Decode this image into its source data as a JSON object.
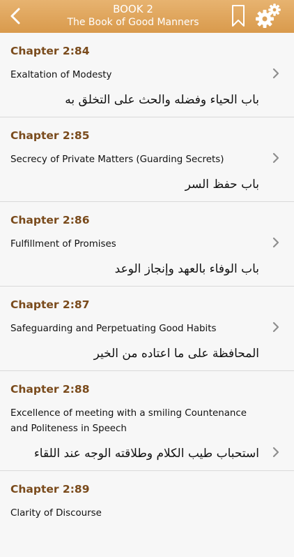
{
  "header": {
    "book_label": "BOOK 2",
    "book_title": "The Book of Good Manners",
    "icons": {
      "back": "chevron-left-icon",
      "bookmark": "bookmark-icon",
      "settings": "gears-icon"
    }
  },
  "colors": {
    "header_top": "#e7b370",
    "header_bottom": "#d99a4c",
    "chapter_number": "#7a4b1c",
    "background": "#f2f2f2"
  },
  "chapters": [
    {
      "number": "Chapter 2:84",
      "english": "Exaltation of Modesty",
      "arabic": "باب الحياء وفضله والحث على التخلق به"
    },
    {
      "number": "Chapter 2:85",
      "english": "Secrecy of Private Matters (Guarding Secrets)",
      "arabic": "باب حفظ السر"
    },
    {
      "number": "Chapter 2:86",
      "english": "Fulfillment of Promises",
      "arabic": "باب الوفاء بالعهد وإنجاز الوعد"
    },
    {
      "number": "Chapter 2:87",
      "english": "Safeguarding and Perpetuating Good Habits",
      "arabic": "المحافظة على ما اعتاده من الخير"
    },
    {
      "number": "Chapter 2:88",
      "english": "Excellence of meeting with a smiling Countenance and Politeness in Speech",
      "arabic": "استحباب طيب الكلام وطلاقته الوجه عند اللقاء"
    },
    {
      "number": "Chapter 2:89",
      "english": "Clarity of Discourse",
      "arabic": ""
    }
  ]
}
